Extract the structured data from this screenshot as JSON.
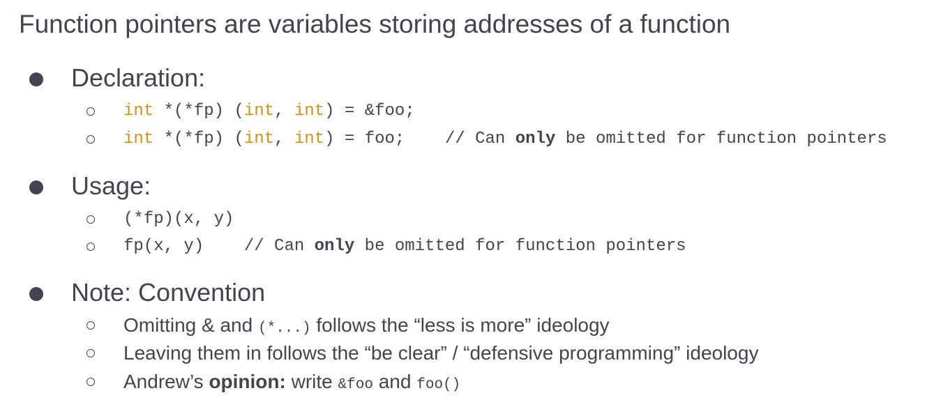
{
  "title": "Function pointers are variables storing addresses of a function",
  "declaration": {
    "heading": "Declaration:",
    "line1": {
      "kw1": "int",
      "p1": " *(*fp) (",
      "kw2": "int",
      "p2": ", ",
      "kw3": "int",
      "p3": ") = &foo;"
    },
    "line2": {
      "kw1": "int",
      "p1": " *(*fp) (",
      "kw2": "int",
      "p2": ", ",
      "kw3": "int",
      "p3": ") = foo;    // Can ",
      "bold": "only",
      "p4": " be omitted for function pointers"
    }
  },
  "usage": {
    "heading": "Usage:",
    "line1": "(*fp)(x, y)",
    "line2": {
      "p1": "fp(x, y)    // Can ",
      "bold": "only",
      "p2": " be omitted for function pointers"
    }
  },
  "note": {
    "heading": "Note: Convention",
    "line1": {
      "t1": "Omitting & and ",
      "code": "(*...)",
      "t2": " follows the “less is more” ideology"
    },
    "line2": "Leaving them in follows the “be clear” / “defensive programming” ideology",
    "line3": {
      "t1": "Andrew’s ",
      "bold": "opinion:",
      "t2": " write ",
      "code1": "&foo",
      "t3": " and ",
      "code2": "foo()"
    }
  }
}
